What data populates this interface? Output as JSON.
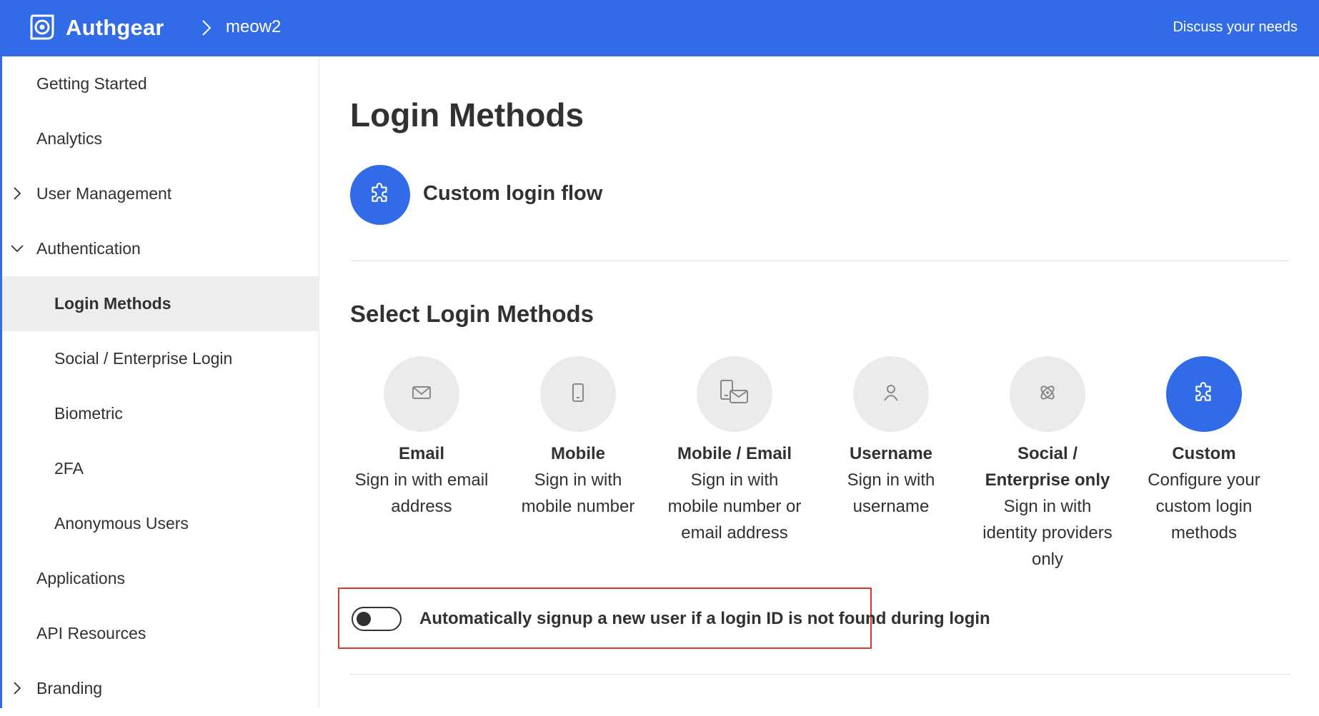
{
  "header": {
    "brand": "Authgear",
    "project": "meow2",
    "link": "Discuss your needs"
  },
  "sidebar": {
    "items": [
      {
        "label": "Getting Started",
        "level": 0,
        "chevron": "none"
      },
      {
        "label": "Analytics",
        "level": 0,
        "chevron": "none"
      },
      {
        "label": "User Management",
        "level": 0,
        "chevron": "right"
      },
      {
        "label": "Authentication",
        "level": 0,
        "chevron": "down"
      },
      {
        "label": "Login Methods",
        "level": 1,
        "active": true
      },
      {
        "label": "Social / Enterprise Login",
        "level": 1
      },
      {
        "label": "Biometric",
        "level": 1
      },
      {
        "label": "2FA",
        "level": 1
      },
      {
        "label": "Anonymous Users",
        "level": 1
      },
      {
        "label": "Applications",
        "level": 0,
        "chevron": "none"
      },
      {
        "label": "API Resources",
        "level": 0,
        "chevron": "none"
      },
      {
        "label": "Branding",
        "level": 0,
        "chevron": "right"
      }
    ]
  },
  "main": {
    "title": "Login Methods",
    "current_flow": "Custom login flow",
    "section_title": "Select Login Methods",
    "methods": [
      {
        "title": "Email",
        "desc": "Sign in with email address",
        "icon": "mail-icon"
      },
      {
        "title": "Mobile",
        "desc": "Sign in with mobile number",
        "icon": "phone-icon"
      },
      {
        "title": "Mobile / Email",
        "desc": "Sign in with mobile number or email address",
        "icon": "phone-mail-icon"
      },
      {
        "title": "Username",
        "desc": "Sign in with username",
        "icon": "user-icon"
      },
      {
        "title": "Social / Enterprise only",
        "desc": "Sign in with identity providers only",
        "icon": "atom-icon"
      },
      {
        "title": "Custom",
        "desc": "Configure your custom login methods",
        "icon": "puzzle-icon",
        "selected": true
      }
    ],
    "auto_signup": {
      "label": "Automatically signup a new user if a login ID is not found during login",
      "enabled": false
    }
  },
  "colors": {
    "accent": "#326be7",
    "highlight_border": "#e0352b",
    "active_nav": "#ededed",
    "icon_circle": "#ebebeb"
  }
}
